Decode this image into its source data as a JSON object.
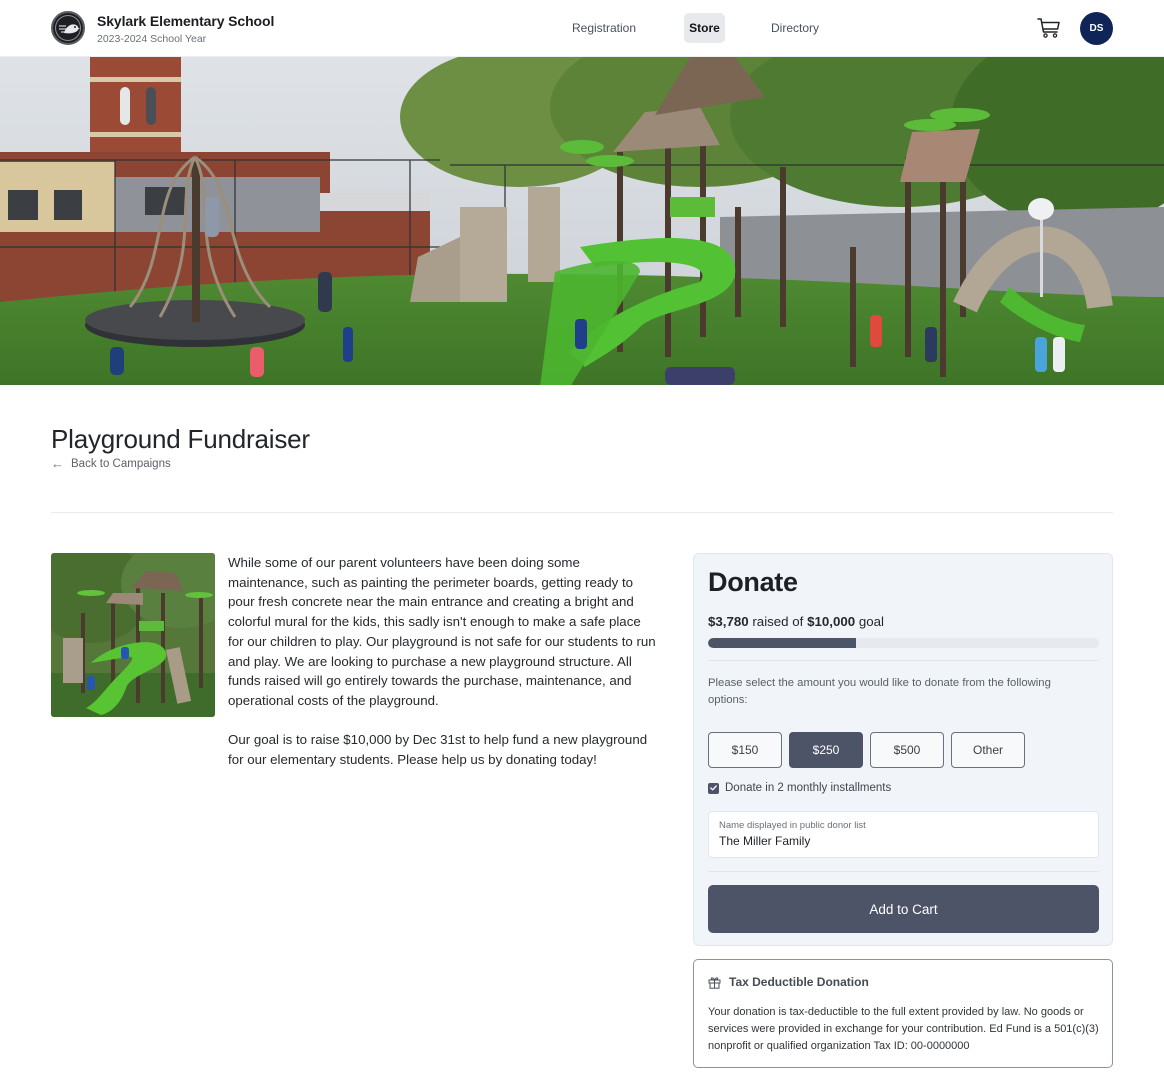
{
  "header": {
    "school_name": "Skylark Elementary School",
    "school_year": "2023-2024 School Year",
    "nav": [
      {
        "label": "Registration",
        "active": false
      },
      {
        "label": "Store",
        "active": true
      },
      {
        "label": "Directory",
        "active": false
      }
    ],
    "cart_icon": "shopping-cart-icon",
    "user_initials": "DS",
    "avatar_color": "#0f2557"
  },
  "hero": {
    "image_description": "Children playing on a new playground with green slides, a spinning climber, climbing walls and a brick school tower in the background"
  },
  "campaign": {
    "title": "Playground Fundraiser",
    "back_link": "Back to Campaigns",
    "back_icon": "arrow-left-icon",
    "thumbnail_description": "Playground structure with green spiral slide",
    "description": [
      "While some of our parent volunteers have been doing some maintenance, such as painting the perimeter boards, getting ready to pour fresh concrete near the main entrance and creating a bright and colorful mural for the kids, this sadly isn't enough to make a safe place for our children to play.  Our playground is not safe for our students to run and play.  We are looking to purchase a new playground structure.  All funds raised will go entirely towards the purchase, maintenance, and operational costs of the playground.",
      "Our goal is to raise $10,000 by Dec 31st to help fund a new playground for our elementary students.  Please help us by donating today!"
    ]
  },
  "donate": {
    "title": "Donate",
    "raised_amount": "$3,780",
    "raised_mid": " raised of ",
    "goal_amount": "$10,000",
    "goal_suffix": " goal",
    "progress_fraction": 0.378,
    "instructions": "Please select the amount you would like to donate from the following options:",
    "amounts": [
      {
        "label": "$150",
        "selected": false
      },
      {
        "label": "$250",
        "selected": true
      },
      {
        "label": "$500",
        "selected": false
      },
      {
        "label": "Other",
        "selected": false
      }
    ],
    "installments_label": "Donate in 2 monthly installments",
    "installments_checked": true,
    "donor_name_label": "Name displayed in public donor list",
    "donor_name_value": "The Miller Family",
    "add_to_cart_label": "Add to Cart",
    "accent_color": "#4e5467"
  },
  "tax": {
    "icon": "gift-icon",
    "title": "Tax Deductible Donation",
    "text": "Your donation is tax-deductible to the full extent provided by law. No goods or services were provided in exchange for your contribution. Ed Fund is a 501(c)(3) nonprofit or qualified organization Tax ID: 00-0000000"
  }
}
